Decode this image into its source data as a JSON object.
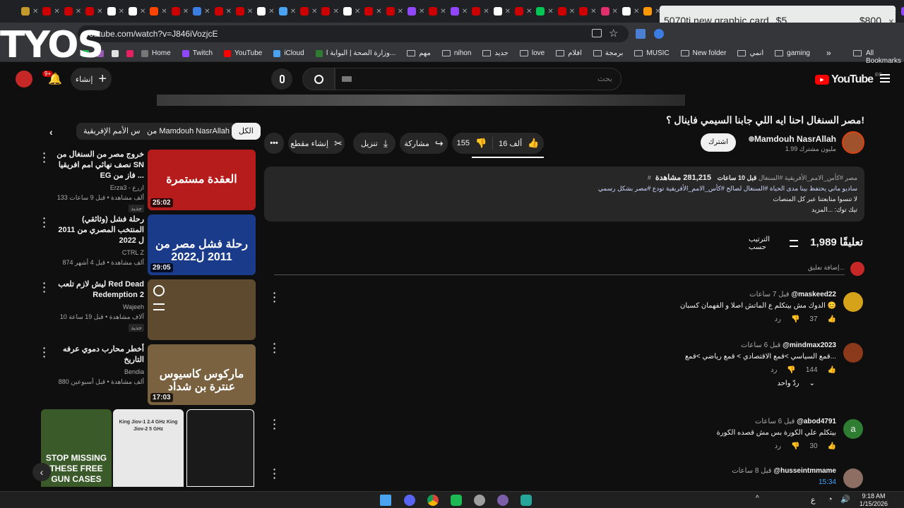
{
  "browser": {
    "url": "youtube.com/watch?v=J846iVozjcE",
    "bookmarks": [
      {
        "label": "Home",
        "kind": "site"
      },
      {
        "label": "Twitch",
        "kind": "site"
      },
      {
        "label": "YouTube",
        "kind": "site"
      },
      {
        "label": "iCloud",
        "kind": "site"
      },
      {
        "label": "وزارة الصحة | البوابة ا...",
        "kind": "site"
      },
      {
        "label": "مهم",
        "kind": "folder"
      },
      {
        "label": "nihon",
        "kind": "folder"
      },
      {
        "label": "جديد",
        "kind": "folder"
      },
      {
        "label": "love",
        "kind": "folder"
      },
      {
        "label": "افلام",
        "kind": "folder"
      },
      {
        "label": "برمجة",
        "kind": "folder"
      },
      {
        "label": "MUSIC",
        "kind": "folder"
      },
      {
        "label": "New folder",
        "kind": "folder"
      },
      {
        "label": "انمي",
        "kind": "folder"
      },
      {
        "label": "gaming",
        "kind": "folder"
      }
    ],
    "all_bookmarks": "All Bookmarks",
    "overflow": "»"
  },
  "overlay": {
    "brand": "TYOS"
  },
  "notice": {
    "title": "5070ti new graphic card",
    "price_low": "$5",
    "price_high": "$800"
  },
  "masthead": {
    "logo": "YouTube",
    "region": "EG",
    "search_placeholder": "بحث",
    "create_label": "إنشاء",
    "notif_count": "9+"
  },
  "video": {
    "title": "مصر السنغال احنا ايه اللي جابنا السيمي فاينال ؟!",
    "channel": "Mamdouh NasrAllah",
    "subscribers": "1.99 مليون مشترك",
    "subscribe_label": "اشترك",
    "likes": "16 ألف",
    "dislikes": "155",
    "share_label": "مشاركة",
    "download_label": "تنزيل",
    "clip_label": "إنشاء مقطع",
    "views": "281,215 مشاهدة",
    "age": "قبل 10 ساعات",
    "tags": "#مصر #كأس_الامم_الأفريقية #السنغال",
    "desc_line1": "ساديو ماني يحتفظ بينا مدى الحياة #السنغال لصالح #كأس_الامم_الأفريقية تودع #مصر بشكل رسمي",
    "desc_line2": "لا تنسوا متابعتنا عبر كل المنصات",
    "desc_line3": "تيك توك: ...المزيد"
  },
  "comments_header": {
    "count": "1,989 تعليقًا",
    "sort_label": "الترتيب حسب",
    "add_placeholder": "إضافة تعليق..."
  },
  "comments": [
    {
      "author": "@maskeed22",
      "age": "قبل 7 ساعات",
      "text": "الدوك مش بيتكلم ع الماتش اصلا و الفهمان كسبان 😊",
      "likes": "37",
      "reply": "رد",
      "avatar_color": "#d6a21a"
    },
    {
      "author": "@mindmax2023",
      "age": "قبل 6 ساعات",
      "text": "قمع السياسي >قمع الاقتصادي > قمع رياضي >قمع...",
      "likes": "144",
      "reply": "رد",
      "avatar_color": "#8a3a1a",
      "replies": "ردّ واحد"
    },
    {
      "author": "@abod4791",
      "age": "قبل 6 ساعات",
      "text": "بيتكلم علي الكورة بس مش قصده الكورة",
      "likes": "30",
      "reply": "رد",
      "avatar_color": "#2e7d32",
      "avatar_letter": "a"
    },
    {
      "author": "@husseintmmame",
      "age": "قبل 8 ساعات",
      "text": "15:34",
      "likes": "",
      "reply": "",
      "avatar_color": "#8d6e63"
    }
  ],
  "filter_chips": [
    "الكل",
    "من Mamdouh NasrAllah",
    "كأس الأمم الإفريقية"
  ],
  "related": [
    {
      "title": "خروج مصر من السنغال من نصف نهائي امم افريقيا SN EG فاز من ...",
      "channel": "Erza3 - ازرع",
      "meta": "133 ألف مشاهدة • قبل 9 ساعات",
      "badge": "جديد",
      "duration": "25:02",
      "thumb_text": "العقدة مستمرة",
      "thumb_bg": "#b71c1c"
    },
    {
      "title": "(وثائقي) رحلة فشل المنتخب المصري من 2011 ل 2022",
      "channel": "CTRL Z",
      "meta": "874 ألف مشاهدة • قبل 4 أشهر",
      "badge": "",
      "duration": "29:05",
      "thumb_text": "رحلة فشل مصر من 2011 ل2022",
      "thumb_bg": "#1a3a8a"
    },
    {
      "title": "ليش لازم تلعب Red Dead Redemption 2",
      "channel": "Wajeeh",
      "meta": "10 آلاف مشاهدة • قبل 19 ساعة",
      "badge": "جديد",
      "duration": "",
      "thumb_text": "",
      "thumb_bg": "#5d4a2f"
    },
    {
      "title": "أخطر محارب دموي عرفه التاريخ",
      "channel": "Bendia",
      "meta": "880 ألف مشاهدة • قبل أسبوعين",
      "badge": "",
      "duration": "17:03",
      "thumb_text": "ماركوس كاسيوس   عنترة بن شداد",
      "thumb_bg": "#7a6240"
    }
  ],
  "shorts": [
    {
      "caption": "STOP MISSING THESE FREE GUN CASES",
      "bg": "#3a5a2a"
    },
    {
      "caption": "King Jiov-1 2.4 GHz  King Jiov-2 5 GHz",
      "bg": "#e8e8e8"
    },
    {
      "caption": "",
      "bg": "#1a1a1a"
    }
  ],
  "taskbar": {
    "time": "9:18 AM",
    "date": "1/15/2026",
    "lang": "ع"
  }
}
